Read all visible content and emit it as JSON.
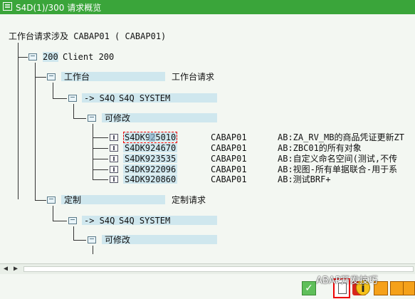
{
  "window": {
    "title": "S4D(1)/300 请求概览"
  },
  "tree": {
    "root": "工作台请求涉及 CABAP01 ( CABAP01)",
    "client": {
      "num": "200",
      "label": "Client 200"
    },
    "workbench": {
      "label": "工作台",
      "desc": "工作台请求",
      "target": {
        "arrow": "-> S4Q",
        "label": "S4Q SYSTEM"
      },
      "modifiable": "可修改",
      "requests": [
        {
          "id": "S4DK925010",
          "owner": "CABAP01",
          "desc": "AB:ZA_RV_MB的商品凭证更新ZT"
        },
        {
          "id": "S4DK924670",
          "owner": "CABAP01",
          "desc": "AB:ZBC01的所有对象"
        },
        {
          "id": "S4DK923535",
          "owner": "CABAP01",
          "desc": "AB:自定义命名空间(测试,不传"
        },
        {
          "id": "S4DK922096",
          "owner": "CABAP01",
          "desc": "AB:视图-所有单据联合-用于系"
        },
        {
          "id": "S4DK920860",
          "owner": "CABAP01",
          "desc": "AB:测试BRF+"
        }
      ]
    },
    "customizing": {
      "label": "定制",
      "desc": "定制请求",
      "target": {
        "arrow": "-> S4Q",
        "label": "S4Q SYSTEM"
      },
      "modifiable": "可修改"
    }
  },
  "toolbar": {
    "ok": "✓",
    "cancel": "✗",
    "info": "i"
  },
  "watermark": "ABAP开发技巧",
  "icons": [
    "folder-icon",
    "request-icon",
    "check-icon",
    "new-request-icon",
    "cancel-icon",
    "info-icon",
    "scroll-left-icon",
    "scroll-right-icon"
  ]
}
